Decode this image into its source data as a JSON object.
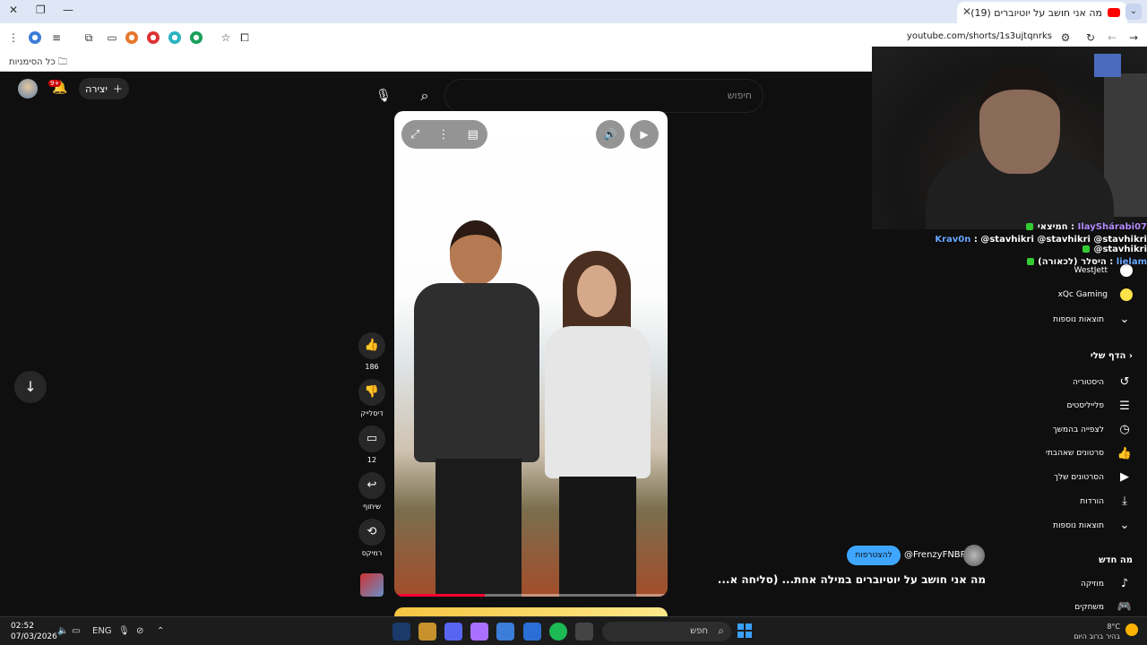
{
  "browser": {
    "tab_title": "(19) מה אני חושב על יוטיוברים",
    "url": "youtube.com/shorts/1s3ujtqnrks",
    "bookmarks_all": "כל הסימניות"
  },
  "youtube": {
    "search_placeholder": "חיפוש",
    "create_label": "יצירה",
    "notifications_badge": "9+",
    "actions": {
      "like_count": "186",
      "dislike_label": "דיסלייק",
      "comment_count": "12",
      "share_label": "שיתוף",
      "remix_label": "רמיקס"
    },
    "channel_name": "@FrenzyFNBR",
    "subscribe_label": "להצטרפות",
    "caption": "מה אני חושב על יוטיוברים במילה אחת... (סליחה א...",
    "progress_fraction": 0.33
  },
  "sidebar": {
    "subscriptions": [
      {
        "name": "WestJett",
        "color": "#ffffff"
      },
      {
        "name": "xQc Gaming",
        "color": "#ffe14a"
      }
    ],
    "more_results": "תוצאות נוספות",
    "my_page_title": "הדף שלי",
    "my_page_items": [
      {
        "label": "היסטוריה",
        "icon": "history-icon",
        "glyph": "↺"
      },
      {
        "label": "פלייליסטים",
        "icon": "playlist-icon",
        "glyph": "☰"
      },
      {
        "label": "לצפייה בהמשך",
        "icon": "clock-icon",
        "glyph": "◷"
      },
      {
        "label": "סרטונים שאהבתי",
        "icon": "thumb-up-icon",
        "glyph": "👍"
      },
      {
        "label": "הסרטונים שלך",
        "icon": "video-icon",
        "glyph": "▶"
      },
      {
        "label": "הורדות",
        "icon": "download-icon",
        "glyph": "⤓"
      }
    ],
    "more_results_2": "תוצאות נוספות",
    "whats_new_title": "מה חדש",
    "whats_new_items": [
      {
        "label": "מוזיקה",
        "icon": "music-icon",
        "glyph": "♪"
      },
      {
        "label": "משחקים",
        "icon": "gamepad-icon",
        "glyph": "🎮"
      }
    ]
  },
  "chat": [
    {
      "user": "IlayShárabi07",
      "text": ": חמיצאי",
      "color": "#b48cff"
    },
    {
      "user": "Krav0n",
      "text": ": @stavhikri @stavhikri @stavhikri @stavhikri",
      "color": "#6aa8ff"
    },
    {
      "user": "lielam",
      "text": ": היסלר (לכאורה)",
      "color": "#6aa8ff"
    }
  ],
  "taskbar": {
    "time": "02:52",
    "date": "07/03/2026",
    "language": "ENG",
    "search_label": "חפש",
    "weather_temp": "8°C",
    "weather_desc": "בהיר ברוב היום"
  }
}
